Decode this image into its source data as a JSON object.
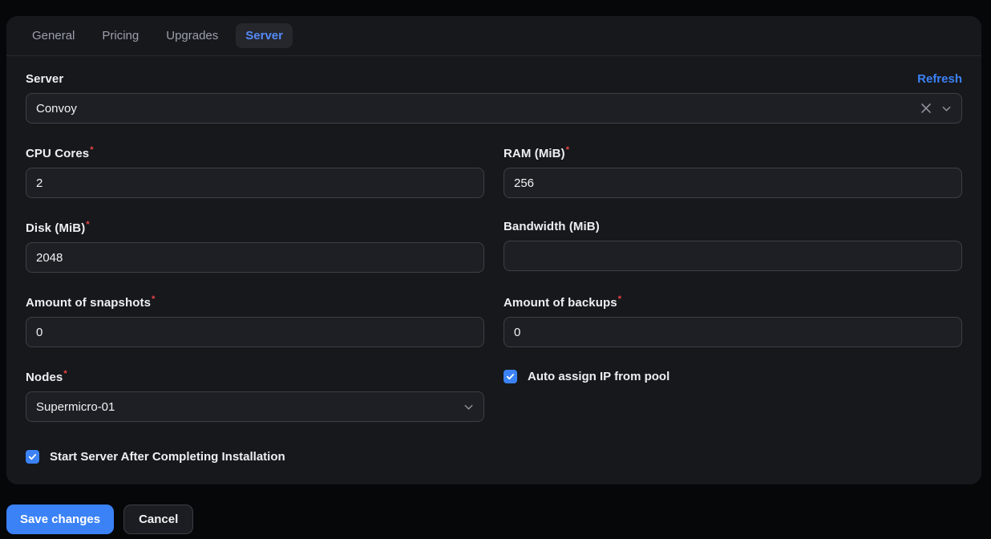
{
  "tabs": [
    {
      "label": "General",
      "active": false
    },
    {
      "label": "Pricing",
      "active": false
    },
    {
      "label": "Upgrades",
      "active": false
    },
    {
      "label": "Server",
      "active": true
    }
  ],
  "panel": {
    "required_marker": "*",
    "refresh_label": "Refresh",
    "server_field": {
      "label": "Server",
      "value": "Convoy"
    },
    "fields": [
      {
        "label": "CPU Cores",
        "required": true,
        "value": "2"
      },
      {
        "label": "RAM (MiB)",
        "required": true,
        "value": "256"
      },
      {
        "label": "Disk (MiB)",
        "required": true,
        "value": "2048"
      },
      {
        "label": "Bandwidth (MiB)",
        "required": false,
        "value": ""
      },
      {
        "label": "Amount of snapshots",
        "required": true,
        "value": "0"
      },
      {
        "label": "Amount of backups",
        "required": true,
        "value": "0"
      }
    ],
    "nodes_field": {
      "label": "Nodes",
      "required": true,
      "value": "Supermicro-01"
    },
    "checkboxes": [
      {
        "label": "Auto assign IP from pool",
        "checked": true
      },
      {
        "label": "Start Server After Completing Installation",
        "checked": true
      }
    ]
  },
  "actions": {
    "save_label": "Save changes",
    "cancel_label": "Cancel"
  },
  "colors": {
    "accent_blue": "#3b82f6",
    "active_tab_text": "#548af7",
    "required_red": "#ef4444",
    "panel_bg": "#17181c",
    "page_bg": "#060709",
    "input_bg": "#1d1f24",
    "input_border": "#3e4046"
  }
}
